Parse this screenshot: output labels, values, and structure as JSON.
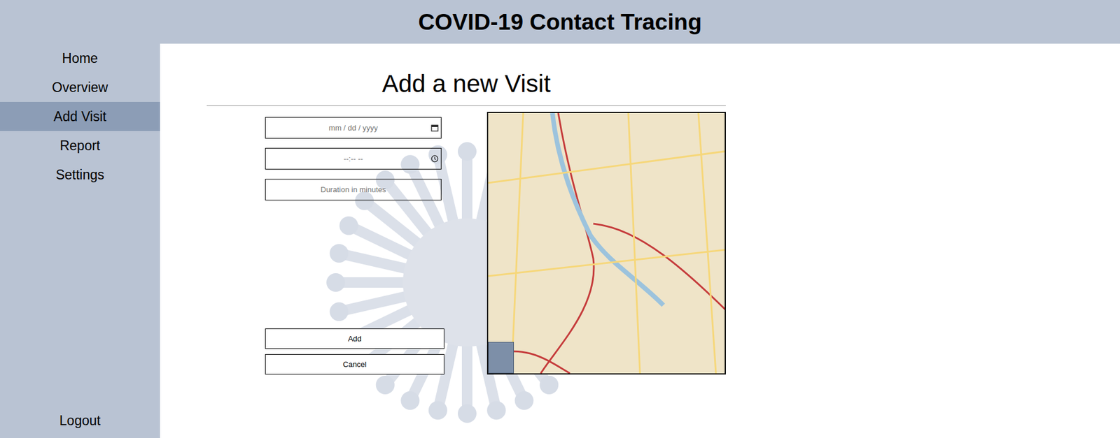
{
  "header": {
    "title": "COVID-19 Contact Tracing"
  },
  "sidebar": {
    "items": [
      {
        "label": "Home",
        "selected": false
      },
      {
        "label": "Overview",
        "selected": false
      },
      {
        "label": "Add Visit",
        "selected": true
      },
      {
        "label": "Report",
        "selected": false
      },
      {
        "label": "Settings",
        "selected": false
      }
    ],
    "logout": "Logout"
  },
  "page": {
    "heading": "Add a new Visit"
  },
  "form": {
    "fields": [
      {
        "kind": "date",
        "placeholder": "mm / dd / yyyy"
      },
      {
        "kind": "time",
        "placeholder": "--:-- --"
      },
      {
        "kind": "number",
        "placeholder": "Duration in minutes"
      }
    ],
    "buttons": [
      "Add",
      "Cancel"
    ]
  }
}
